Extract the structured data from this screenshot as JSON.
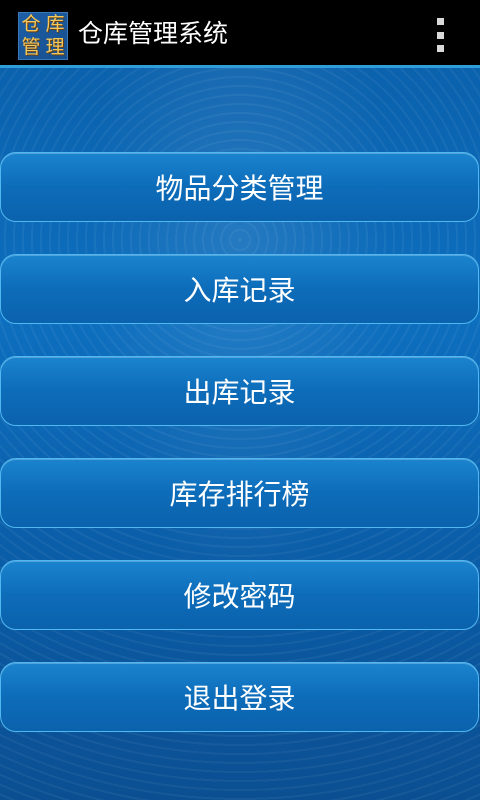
{
  "app": {
    "icon_chars": [
      "仓",
      "库",
      "管",
      "理"
    ],
    "title": "仓库管理系统"
  },
  "menu": {
    "items": [
      {
        "label": "物品分类管理"
      },
      {
        "label": "入库记录"
      },
      {
        "label": "出库记录"
      },
      {
        "label": "库存排行榜"
      },
      {
        "label": "修改密码"
      },
      {
        "label": "退出登录"
      }
    ]
  },
  "colors": {
    "action_bar": "#000000",
    "action_bar_divider": "#2f9ed8",
    "background": "#0d6fbf",
    "button_border": "#4fb8f0"
  }
}
